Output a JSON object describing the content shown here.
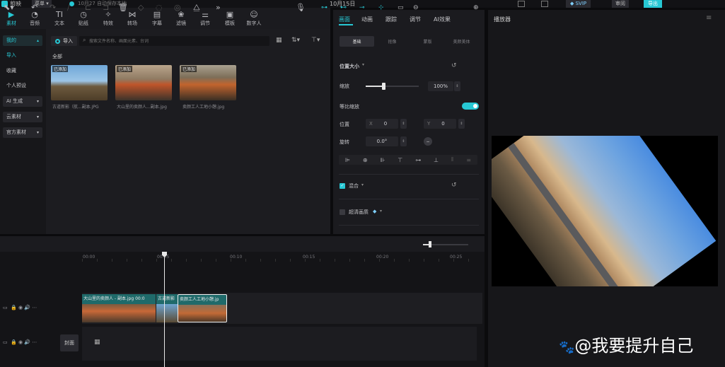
{
  "titlebar": {
    "app_name": "剪映",
    "menu_label": "菜单",
    "draft_status": "10月27 自动保存本地",
    "project_title": "10月15日",
    "vip_label": "SVIP",
    "review_label": "审阅",
    "export_label": "导出"
  },
  "toolbar": {
    "items": [
      {
        "label": "素材",
        "icon": "media-icon"
      },
      {
        "label": "音频",
        "icon": "audio-icon"
      },
      {
        "label": "文本",
        "icon": "text-icon"
      },
      {
        "label": "贴纸",
        "icon": "sticker-icon"
      },
      {
        "label": "特效",
        "icon": "effects-icon"
      },
      {
        "label": "转场",
        "icon": "transition-icon"
      },
      {
        "label": "字幕",
        "icon": "subtitle-icon"
      },
      {
        "label": "滤镜",
        "icon": "filter-icon"
      },
      {
        "label": "调节",
        "icon": "adjust-icon"
      },
      {
        "label": "模板",
        "icon": "template-icon"
      },
      {
        "label": "数字人",
        "icon": "digital-human-icon"
      }
    ]
  },
  "sidebar": {
    "items": [
      {
        "label": "我的"
      },
      {
        "label": "导入"
      },
      {
        "label": "收藏"
      },
      {
        "label": "个人预设"
      },
      {
        "label": "AI 生成"
      },
      {
        "label": "云素材"
      },
      {
        "label": "官方素材"
      }
    ]
  },
  "media": {
    "import_label": "导入",
    "search_placeholder": "搜索文件名称、画面元素、台词",
    "filter_label": "全部",
    "items": [
      {
        "badge": "已添加",
        "name": "古道新影（航...副本.JPG"
      },
      {
        "badge": "已添加",
        "name": "大山里的卖颜人...副本.jpg"
      },
      {
        "badge": "已添加",
        "name": "卖颜工人工地小憩.jpg"
      }
    ]
  },
  "props": {
    "tabs": [
      "画面",
      "动画",
      "跟踪",
      "调节",
      "AI效果"
    ],
    "subtabs": [
      "基础",
      "抠像",
      "蒙版",
      "美颜美体"
    ],
    "section_position": "位置大小",
    "scale_label": "缩放",
    "scale_value": "100%",
    "scale_level": 0.33,
    "uniform_label": "等比缩放",
    "position_label": "位置",
    "x_label": "X",
    "x_value": "0",
    "y_label": "Y",
    "y_value": "0",
    "rotate_label": "旋转",
    "rotate_value": "0.0°",
    "blend_label": "混合",
    "hd_label": "超清画质"
  },
  "player": {
    "title": "播放器"
  },
  "timeline": {
    "ticks": [
      "00:00",
      "00:05",
      "00:10",
      "00:15",
      "00:20",
      "00:25"
    ],
    "clips": [
      {
        "label": "大山里的卖颜人 - 副本.jpg  00:0"
      },
      {
        "label": "古道新影"
      },
      {
        "label": "卖颜工人工地小憩.jp"
      }
    ],
    "cover_label": "封面"
  },
  "watermark": "@我要提升自己",
  "colors": {
    "accent": "#27c8d4",
    "clip": "#1f5f60",
    "panel": "#1b1b1f"
  }
}
